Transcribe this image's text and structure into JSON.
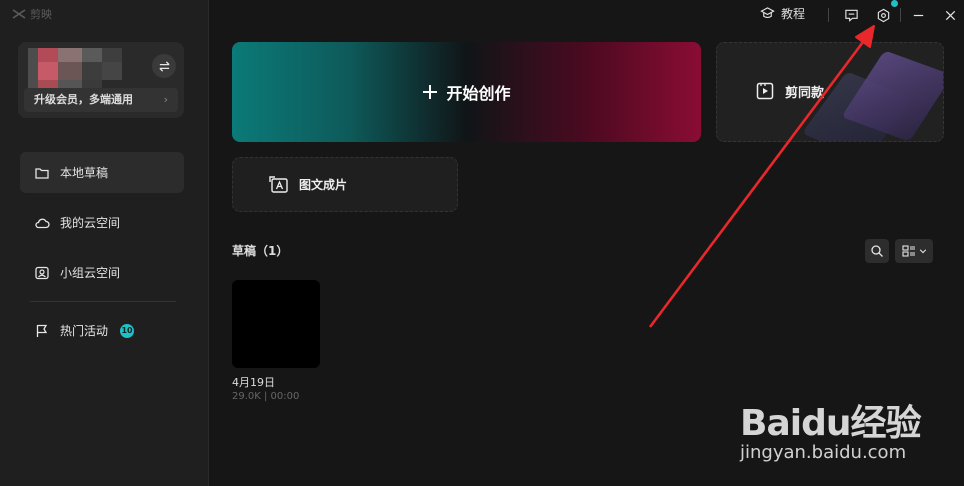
{
  "app": {
    "logo_text": "剪映"
  },
  "user": {
    "upgrade_text": "升级会员，多端通用",
    "upgrade_arrow": "›"
  },
  "nav": {
    "items": [
      {
        "label": "本地草稿",
        "icon": "folder-icon",
        "active": true
      },
      {
        "label": "我的云空间",
        "icon": "cloud-icon"
      },
      {
        "label": "小组云空间",
        "icon": "team-cloud-icon"
      }
    ],
    "hot": {
      "label": "热门活动",
      "badge": "10",
      "icon": "flag-icon"
    }
  },
  "titlebar": {
    "tutorial_label": "教程"
  },
  "main": {
    "start_label": "开始创作",
    "template_label": "剪同款",
    "imgtext_label": "图文成片",
    "drafts_title": "草稿（1）"
  },
  "drafts": [
    {
      "name": "4月19日",
      "meta": "29.0K | 00:00"
    }
  ],
  "watermark": {
    "main": "Baidu经验",
    "sub": "jingyan.baidu.com"
  },
  "colors": {
    "accent": "#1ec2c6",
    "arrow": "#e8282b"
  }
}
